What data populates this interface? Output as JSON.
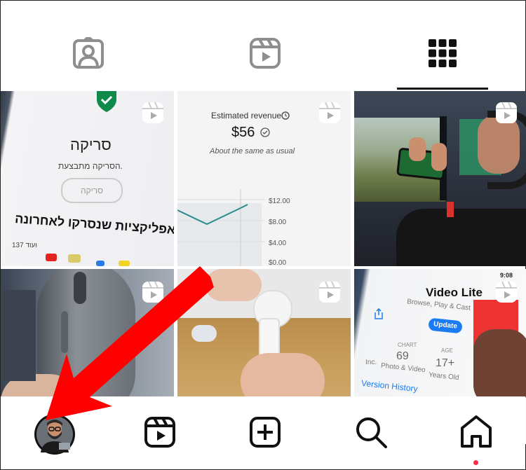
{
  "profile_tabs": [
    {
      "name": "tagged",
      "icon": "tagged-person-icon",
      "active": false
    },
    {
      "name": "reels",
      "icon": "reels-icon",
      "active": false
    },
    {
      "name": "posts-grid",
      "icon": "grid-icon",
      "active": true
    }
  ],
  "posts": {
    "p1": {
      "title": "סריקה",
      "subtitle": "הסריקה מתבצעת.",
      "button": "סריקה",
      "heading": "אפליקציות שנסרקו לאחרונה",
      "more": "ועוד 137"
    },
    "p2": {
      "label": "Estimated revenue",
      "amount": "$56",
      "note": "About the same as usual",
      "y_ticks": [
        "$12.00",
        "$8.00",
        "$4.00",
        "$0.00"
      ]
    },
    "p5": {},
    "p6": {
      "time": "9:08",
      "app_name": "Video Lite",
      "app_tagline": "Browse, Play & Cast",
      "update": "Update",
      "chart_label": "CHART",
      "chart_value": "69",
      "chart_sub": "Photo & Video",
      "age_label": "AGE",
      "age_value": "17+",
      "age_sub": "Years Old",
      "version_history": "Version History",
      "side_cut": "Inc."
    }
  },
  "bottom_nav": [
    {
      "name": "profile",
      "icon": "avatar"
    },
    {
      "name": "reels",
      "icon": "reels-icon"
    },
    {
      "name": "create",
      "icon": "plus-square-icon"
    },
    {
      "name": "search",
      "icon": "search-icon"
    },
    {
      "name": "home",
      "icon": "home-icon",
      "notification_dot": true
    }
  ],
  "annotation": {
    "color": "#ff0000",
    "shape": "arrow",
    "points_to": "profile"
  },
  "colors": {
    "reel_badge": "#ffffff",
    "notification": "#ff2d4a",
    "update_button": "#1a7cf2"
  }
}
